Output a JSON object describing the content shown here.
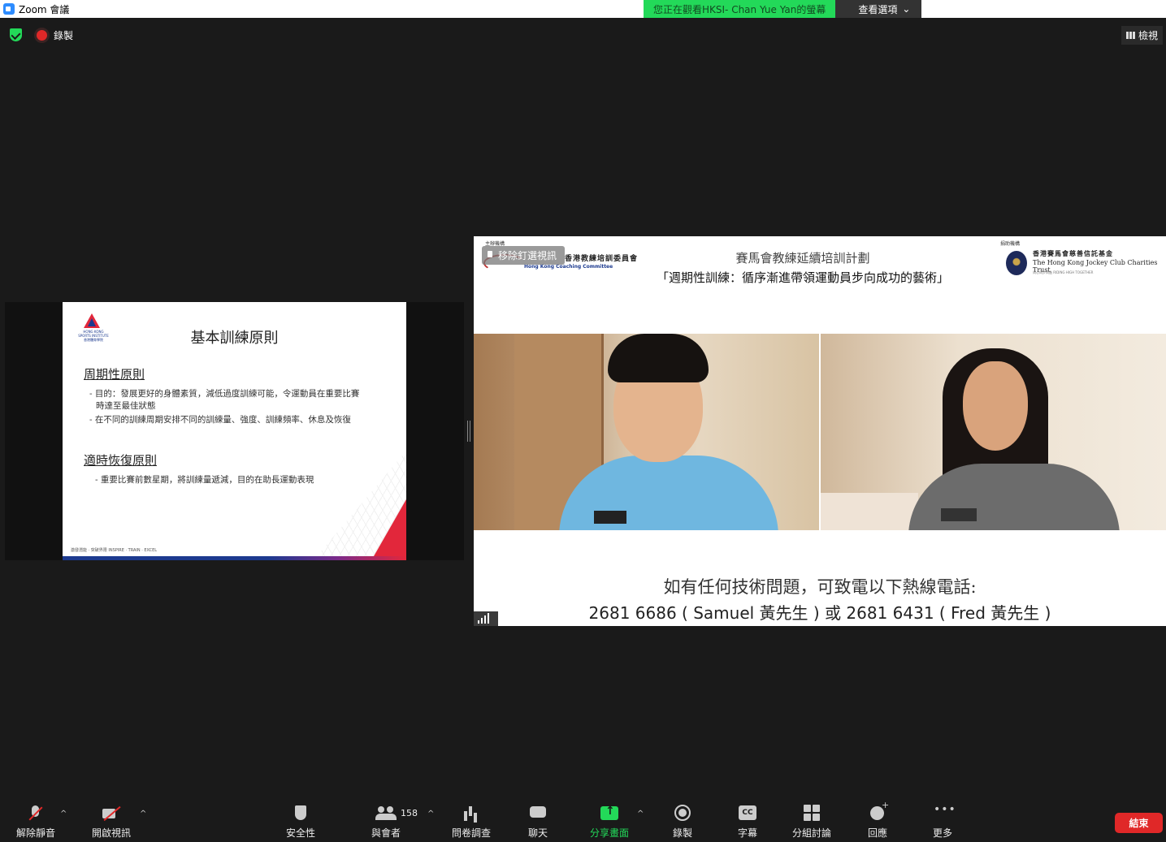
{
  "window": {
    "title": "Zoom 會議"
  },
  "share_banner": {
    "viewing_text": "您正在觀看HKSI- Chan Yue Yan的螢幕",
    "view_options": "查看選項",
    "caret": "⌄"
  },
  "top_status": {
    "recording_label": "錄製",
    "view_label": "檢視"
  },
  "slide": {
    "logo_text": "HONG KONG SPORTS INSTITUTE 香港體育學院",
    "title": "基本訓練原則",
    "section1": "周期性原則",
    "bullet1a": "- 目的：發展更好的身體素質，減低過度訓練可能，令運動員在重要比賽",
    "bullet1b": "時達至最佳狀態",
    "bullet2": "- 在不同的訓練周期安排不同的訓練量、強度、訓練頻率、休息及恢復",
    "section2": "適時恢復原則",
    "bullet3": "- 重要比賽前數星期，將訓練量遞減，目的在助長運動表現",
    "footer": "激發潛能 · 突破界限 INSPIRE · TRAIN · EXCEL"
  },
  "video": {
    "pin_label": "移除釘選視訊",
    "org_small": "主辦機構",
    "org_cn": "香港教練培訓委員會",
    "org_en": "Hong Kong Coaching Committee",
    "title1": "賽馬會教練延續培訓計劃",
    "title2": "「週期性訓練：循序漸進帶領運動員步向成功的藝術」",
    "sponsor_small": "捐助機構",
    "sponsor_cn": "香港賽馬會慈善信託基金",
    "sponsor_en": "The Hong Kong Jockey Club Charities Trust",
    "sponsor_tag": "同心同步同進 RIDING HIGH TOGETHER",
    "hotline1": "如有任何技術問題，可致電以下熱線電話:",
    "hotline2": "2681 6686 ( Samuel 黃先生 ) 或 2681 6431 ( Fred 黃先生 )"
  },
  "toolbar": {
    "unmute": "解除靜音",
    "start_video": "開啟視訊",
    "security": "安全性",
    "participants": "與會者",
    "participants_count": "158",
    "polls": "問卷調查",
    "chat": "聊天",
    "share_screen": "分享畫面",
    "record": "錄製",
    "captions": "字幕",
    "breakout": "分組討論",
    "reactions": "回應",
    "more": "更多",
    "end": "結束",
    "caret": "^"
  },
  "colors": {
    "accent_green": "#23d959",
    "end_red": "#e02828",
    "bg": "#1a1a1a"
  }
}
